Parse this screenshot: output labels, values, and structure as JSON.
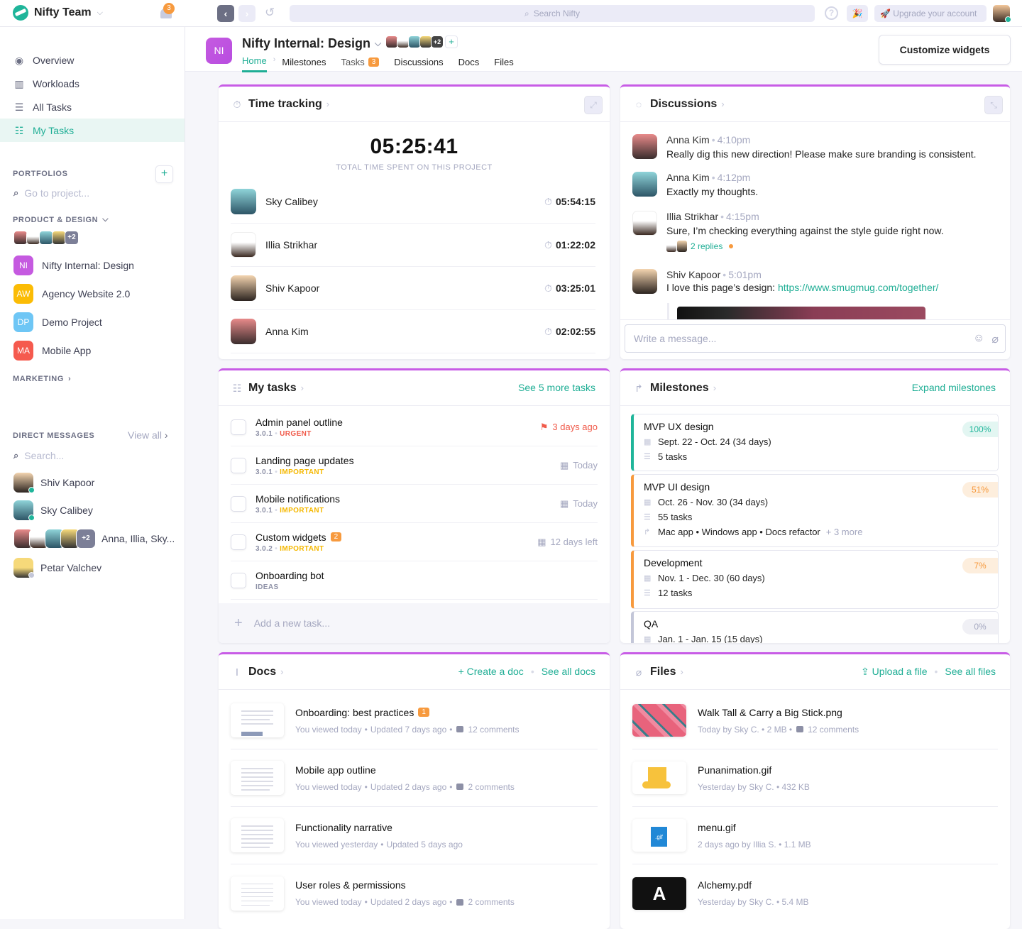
{
  "topbar": {
    "workspace": "Nifty Team",
    "notifications_count": "3",
    "search_placeholder": "Search Nifty",
    "help_label": "?",
    "upgrade_label": "🚀 Upgrade your account",
    "party_icon": "🎉"
  },
  "sidebar": {
    "nav": [
      {
        "label": "Overview",
        "icon": "compass-icon"
      },
      {
        "label": "Workloads",
        "icon": "bar-chart-icon"
      },
      {
        "label": "All Tasks",
        "icon": "list-icon"
      },
      {
        "label": "My Tasks",
        "icon": "checklist-icon",
        "active": true
      }
    ],
    "portfolios_header": "PORTFOLIOS",
    "project_search_placeholder": "Go to project...",
    "group_header": "PRODUCT & DESIGN",
    "group_members_more": "+2",
    "projects": [
      {
        "initials": "NI",
        "name": "Nifty Internal: Design",
        "color": "#c55ae0"
      },
      {
        "initials": "AW",
        "name": "Agency Website 2.0",
        "color": "#fbbc05"
      },
      {
        "initials": "DP",
        "name": "Demo Project",
        "color": "#6ec6f5"
      },
      {
        "initials": "MA",
        "name": "Mobile App",
        "color": "#f55a4e"
      }
    ],
    "marketing_header": "MARKETING",
    "dm_header": "DIRECT MESSAGES",
    "dm_view_all": "View all",
    "dm_search_placeholder": "Search...",
    "dms": [
      {
        "name": "Shiv Kapoor",
        "status": "online"
      },
      {
        "name": "Sky Calibey",
        "status": "online"
      },
      {
        "name": "Anna, Illia, Sky...",
        "more": "+2"
      },
      {
        "name": "Petar Valchev",
        "status": "offline"
      }
    ]
  },
  "project": {
    "initials": "NI",
    "title": "Nifty Internal: Design",
    "members_more": "+2",
    "add_member": "+",
    "tabs": [
      {
        "label": "Home",
        "active": true
      },
      {
        "label": "Milestones"
      },
      {
        "label": "Tasks",
        "badge": "3"
      },
      {
        "label": "Discussions"
      },
      {
        "label": "Docs"
      },
      {
        "label": "Files"
      }
    ],
    "customize_label": "Customize widgets"
  },
  "time_tracking": {
    "title": "Time tracking",
    "total": "05:25:41",
    "total_label": "TOTAL TIME SPENT ON THIS PROJECT",
    "rows": [
      {
        "name": "Sky Calibey",
        "time": "05:54:15"
      },
      {
        "name": "Illia Strikhar",
        "time": "01:22:02"
      },
      {
        "name": "Shiv Kapoor",
        "time": "03:25:01"
      },
      {
        "name": "Anna Kim",
        "time": "02:02:55"
      }
    ]
  },
  "discussions": {
    "title": "Discussions",
    "messages": [
      {
        "author": "Anna Kim",
        "time": "4:10pm",
        "text": "Really dig this new direction! Please make sure branding is consistent."
      },
      {
        "author": "Anna Kim",
        "time": "4:12pm",
        "text": "Exactly my thoughts."
      },
      {
        "author": "Illia Strikhar",
        "time": "4:15pm",
        "text": "Sure, I’m checking everything against the style guide right now.",
        "replies": "2 replies"
      },
      {
        "author": "Shiv Kapoor",
        "time": "5:01pm",
        "text": "I love this page’s design: ",
        "link": "https://www.smugmug.com/together/"
      }
    ],
    "input_placeholder": "Write a message..."
  },
  "my_tasks": {
    "title": "My tasks",
    "see_more": "See 5 more tasks",
    "tasks": [
      {
        "title": "Admin panel outline",
        "version": "3.0.1",
        "tag": "URGENT",
        "tag_type": "urgent",
        "due": "3 days ago",
        "overdue": true
      },
      {
        "title": "Landing page updates",
        "version": "3.0.1",
        "tag": "IMPORTANT",
        "tag_type": "important",
        "due": "Today"
      },
      {
        "title": "Mobile notifications",
        "version": "3.0.1",
        "tag": "IMPORTANT",
        "tag_type": "important",
        "due": "Today"
      },
      {
        "title": "Custom widgets",
        "badge": "2",
        "version": "3.0.2",
        "tag": "IMPORTANT",
        "tag_type": "important",
        "due": "12 days left"
      },
      {
        "title": "Onboarding bot",
        "tag": "IDEAS",
        "tag_type": "ideas"
      }
    ],
    "add_placeholder": "Add a new task..."
  },
  "milestones": {
    "title": "Milestones",
    "expand": "Expand milestones",
    "items": [
      {
        "title": "MVP UX design",
        "dates": "Sept. 22 - Oct. 24 (34 days)",
        "tasks": "5 tasks",
        "progress": "100%",
        "color": "#1fb59a"
      },
      {
        "title": "MVP UI design",
        "dates": "Oct. 26 - Nov. 30 (34 days)",
        "tasks": "55 tasks",
        "deps": "Mac app • Windows app • Docs refactor",
        "deps_more": "+ 3 more",
        "progress": "51%",
        "color": "#f79a3e"
      },
      {
        "title": "Development",
        "dates": "Nov. 1 - Dec. 30 (60 days)",
        "tasks": "12 tasks",
        "progress": "7%",
        "color": "#f79a3e"
      },
      {
        "title": "QA",
        "dates": "Jan. 1 - Jan. 15 (15 days)",
        "progress": "0%",
        "color": "#c3c6d8"
      }
    ]
  },
  "docs": {
    "title": "Docs",
    "create": "+ Create a doc",
    "see_all": "See all docs",
    "items": [
      {
        "title": "Onboarding: best practices",
        "badge": "1",
        "viewed": "You viewed today",
        "updated": "Updated 7 days ago",
        "comments": "12 comments"
      },
      {
        "title": "Mobile app outline",
        "viewed": "You viewed today",
        "updated": "Updated 2 days ago",
        "comments": "2 comments"
      },
      {
        "title": "Functionality narrative",
        "viewed": "You viewed yesterday",
        "updated": "Updated 5 days ago"
      },
      {
        "title": "User roles & permissions",
        "viewed": "You viewed today",
        "updated": "Updated 2 days ago",
        "comments": "2 comments"
      }
    ]
  },
  "files": {
    "title": "Files",
    "upload": "Upload a file",
    "see_all": "See all files",
    "items": [
      {
        "name": "Walk Tall & Carry a Big Stick.png",
        "meta": "Today by Sky C. • 2 MB •",
        "comments": "12 comments"
      },
      {
        "name": "Punanimation.gif",
        "meta": "Yesterday by Sky C. • 432 KB"
      },
      {
        "name": "menu.gif",
        "meta": "2 days ago by Illia S. • 1.1 MB",
        "thumb_label": ".gif"
      },
      {
        "name": "Alchemy.pdf",
        "meta": "Yesterday by Sky C. • 5.4 MB",
        "thumb_label": "A"
      }
    ]
  }
}
